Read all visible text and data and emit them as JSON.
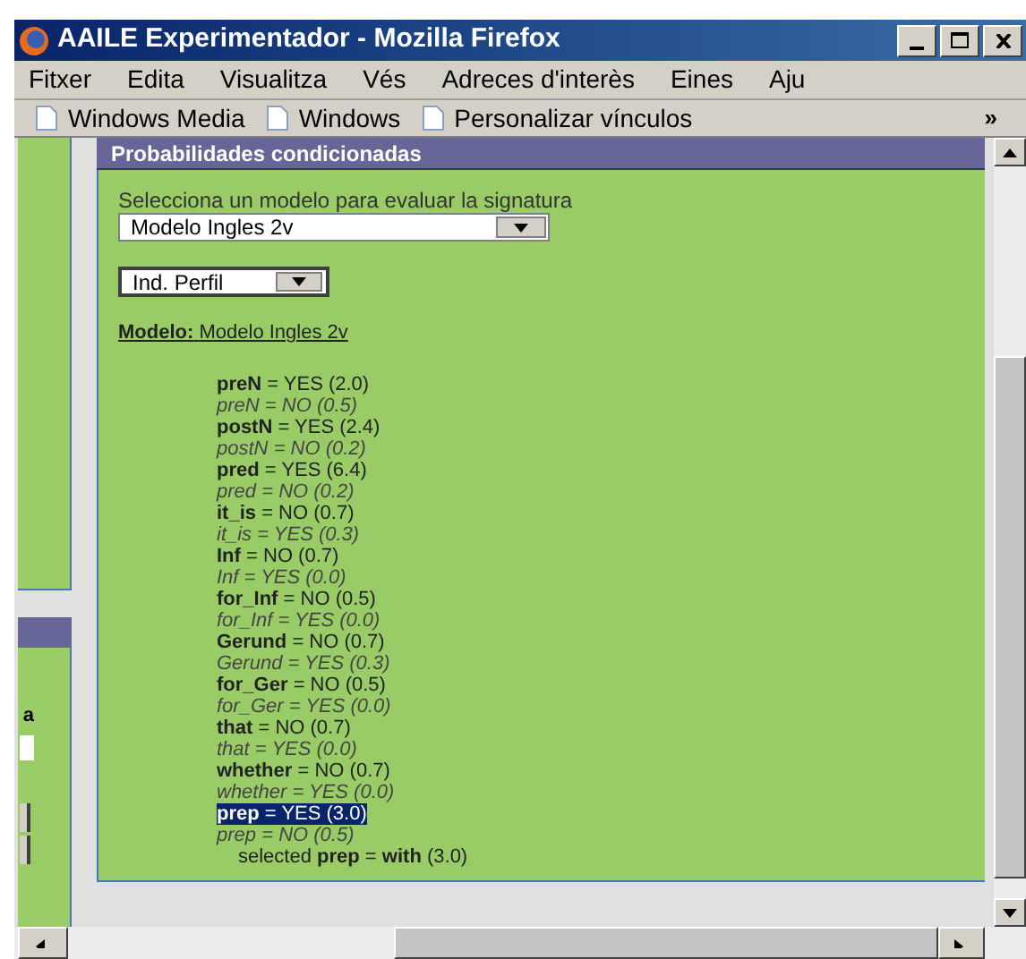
{
  "window": {
    "title": "AAILE Experimentador - Mozilla Firefox"
  },
  "menu": [
    {
      "label": "Fitxer"
    },
    {
      "label": "Edita"
    },
    {
      "label": "Visualitza"
    },
    {
      "label": "Vés"
    },
    {
      "label": "Adreces d'interès"
    },
    {
      "label": "Eines"
    },
    {
      "label": "Aju"
    }
  ],
  "bookmarks": [
    {
      "label": "Windows Media"
    },
    {
      "label": "Windows"
    },
    {
      "label": "Personalizar vínculos"
    }
  ],
  "bookmarks_more": "»",
  "left_panel": {
    "label": "a"
  },
  "panel": {
    "title": "Probabilidades condicionadas",
    "model_prompt": "Selecciona un modelo para evaluar la signatura",
    "model_select": "Modelo Ingles 2v",
    "profile_select": "Ind. Perfil",
    "model_label": "Modelo:",
    "model_name": "Modelo Ingles 2v",
    "rows": [
      {
        "name": "preN",
        "value": "= YES (2.0)",
        "kind": "primary",
        "selected": false
      },
      {
        "name": "preN",
        "value": "= NO (0.5)",
        "kind": "alternative",
        "selected": false
      },
      {
        "name": "postN",
        "value": "= YES (2.4)",
        "kind": "primary",
        "selected": false
      },
      {
        "name": "postN",
        "value": "= NO (0.2)",
        "kind": "alternative",
        "selected": false
      },
      {
        "name": "pred",
        "value": "= YES (6.4)",
        "kind": "primary",
        "selected": false
      },
      {
        "name": "pred",
        "value": "= NO (0.2)",
        "kind": "alternative",
        "selected": false
      },
      {
        "name": "it_is",
        "value": "= NO (0.7)",
        "kind": "primary",
        "selected": false
      },
      {
        "name": "it_is",
        "value": "= YES (0.3)",
        "kind": "alternative",
        "selected": false
      },
      {
        "name": "Inf",
        "value": "= NO (0.7)",
        "kind": "primary",
        "selected": false
      },
      {
        "name": "Inf",
        "value": "= YES (0.0)",
        "kind": "alternative",
        "selected": false
      },
      {
        "name": "for_Inf",
        "value": "= NO (0.5)",
        "kind": "primary",
        "selected": false
      },
      {
        "name": "for_Inf",
        "value": "= YES (0.0)",
        "kind": "alternative",
        "selected": false
      },
      {
        "name": "Gerund",
        "value": "= NO (0.7)",
        "kind": "primary",
        "selected": false
      },
      {
        "name": "Gerund",
        "value": "= YES (0.3)",
        "kind": "alternative",
        "selected": false
      },
      {
        "name": "for_Ger",
        "value": "= NO (0.5)",
        "kind": "primary",
        "selected": false
      },
      {
        "name": "for_Ger",
        "value": "= YES (0.0)",
        "kind": "alternative",
        "selected": false
      },
      {
        "name": "that",
        "value": "= NO (0.7)",
        "kind": "primary",
        "selected": false
      },
      {
        "name": "that",
        "value": "= YES (0.0)",
        "kind": "alternative",
        "selected": false
      },
      {
        "name": "whether",
        "value": "= NO (0.7)",
        "kind": "primary",
        "selected": false
      },
      {
        "name": "whether",
        "value": "= YES (0.0)",
        "kind": "alternative",
        "selected": false
      },
      {
        "name": "prep",
        "value": "= YES (3.0)",
        "kind": "primary",
        "selected": true
      },
      {
        "name": "prep",
        "value": "= NO (0.5)",
        "kind": "alternative",
        "selected": false
      }
    ],
    "result": "selected **prep** = **with** (3.0)"
  }
}
